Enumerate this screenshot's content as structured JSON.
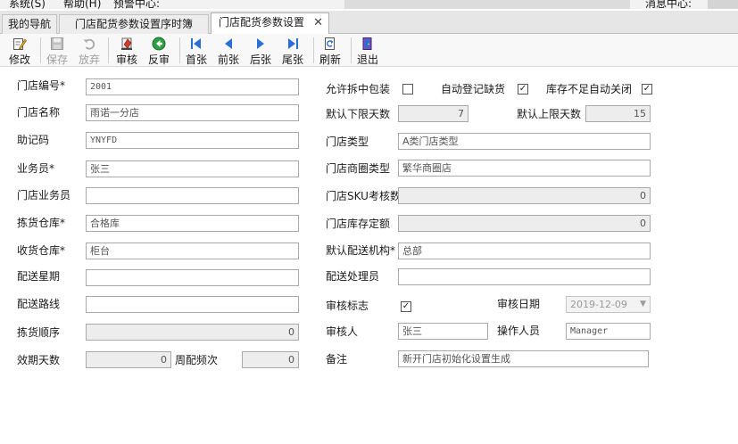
{
  "menu": {
    "system": "系统(S)",
    "help": "帮助(H)",
    "alert_center": "预警中心:",
    "message_center": "消息中心:"
  },
  "tabs": [
    {
      "label": "我的导航"
    },
    {
      "label": "门店配货参数设置序时簿"
    },
    {
      "label": "门店配货参数设置",
      "close": "✕"
    }
  ],
  "toolbar": {
    "edit": "修改",
    "save": "保存",
    "discard": "放弃",
    "approve": "审核",
    "unapprove": "反审",
    "first": "首张",
    "prev": "前张",
    "next": "后张",
    "last": "尾张",
    "refresh": "刷新",
    "exit": "退出"
  },
  "form": {
    "store_code": {
      "label": "门店编号*",
      "value": "2001"
    },
    "store_name": {
      "label": "门店名称",
      "value": "雨诺一分店"
    },
    "mnemonic": {
      "label": "助记码",
      "value": "YNYFD"
    },
    "salesman": {
      "label": "业务员*",
      "value": "张三"
    },
    "store_salesman": {
      "label": "门店业务员",
      "value": ""
    },
    "picking_warehouse": {
      "label": "拣货仓库*",
      "value": "合格库"
    },
    "receiving_warehouse": {
      "label": "收货仓库*",
      "value": "柜台"
    },
    "delivery_week": {
      "label": "配送星期",
      "value": ""
    },
    "delivery_route": {
      "label": "配送路线",
      "value": ""
    },
    "picking_order": {
      "label": "拣货顺序",
      "value": "0"
    },
    "valid_days": {
      "label": "效期天数",
      "value": "0"
    },
    "weekly_frequency": {
      "label": "周配频次",
      "value": "0"
    },
    "allow_split": {
      "label": "允许拆中包装",
      "checked": false
    },
    "auto_register": {
      "label": "自动登记缺货",
      "checked": true
    },
    "auto_close": {
      "label": "库存不足自动关闭",
      "checked": true
    },
    "min_days": {
      "label": "默认下限天数",
      "value": "7"
    },
    "max_days": {
      "label": "默认上限天数",
      "value": "15"
    },
    "store_type": {
      "label": "门店类型",
      "value": "A类门店类型"
    },
    "business_district_type": {
      "label": "门店商圈类型",
      "value": "繁华商圈店"
    },
    "sku_check_count": {
      "label": "门店SKU考核数",
      "value": "0"
    },
    "stock_quota": {
      "label": "门店库存定额",
      "value": "0"
    },
    "default_delivery_org": {
      "label": "默认配送机构*",
      "value": "总部"
    },
    "delivery_handler": {
      "label": "配送处理员",
      "value": ""
    },
    "approved_flag": {
      "label": "审核标志",
      "checked": true
    },
    "approved_date": {
      "label": "审核日期",
      "value": "2019-12-09"
    },
    "approver": {
      "label": "审核人",
      "value": "张三"
    },
    "operator": {
      "label": "操作人员",
      "value": "Manager"
    },
    "remark": {
      "label": "备注",
      "value": "新开门店初始化设置生成"
    }
  },
  "colors": {
    "tab_active": "#ffffff",
    "tab_inactive": "#ededed",
    "readonly_field": "#ededed",
    "toolbar_blue": "#2a6fd6"
  }
}
